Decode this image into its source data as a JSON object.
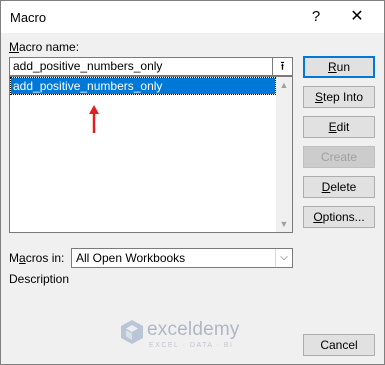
{
  "window": {
    "title": "Macro",
    "help_label": "?",
    "close_label": "✕"
  },
  "macro_name": {
    "label_prefix": "",
    "label_mnemonic": "M",
    "label_rest": "acro name:",
    "value": "add_positive_numbers_only",
    "upload_icon": "⭱"
  },
  "macro_list": {
    "items": [
      "add_positive_numbers_only"
    ],
    "selected_index": 0
  },
  "buttons": {
    "run": {
      "mnemonic": "R",
      "rest": "un"
    },
    "step_into": {
      "mnemonic": "S",
      "rest": "tep Into"
    },
    "edit": {
      "mnemonic": "E",
      "rest": "dit"
    },
    "create": {
      "mnemonic": "",
      "rest": "Create"
    },
    "delete": {
      "mnemonic": "D",
      "rest": "elete"
    },
    "options": {
      "mnemonic": "O",
      "rest": "ptions..."
    },
    "cancel": {
      "label": "Cancel"
    }
  },
  "macros_in": {
    "label_pre": "M",
    "label_mnemonic": "a",
    "label_rest": "cros in:",
    "value": "All Open Workbooks"
  },
  "description": {
    "label": "Description"
  },
  "watermark": {
    "name": "exceldemy",
    "tagline": "EXCEL · DATA · BI"
  },
  "colors": {
    "selection": "#0078d7",
    "annotation_arrow": "#e02020"
  }
}
